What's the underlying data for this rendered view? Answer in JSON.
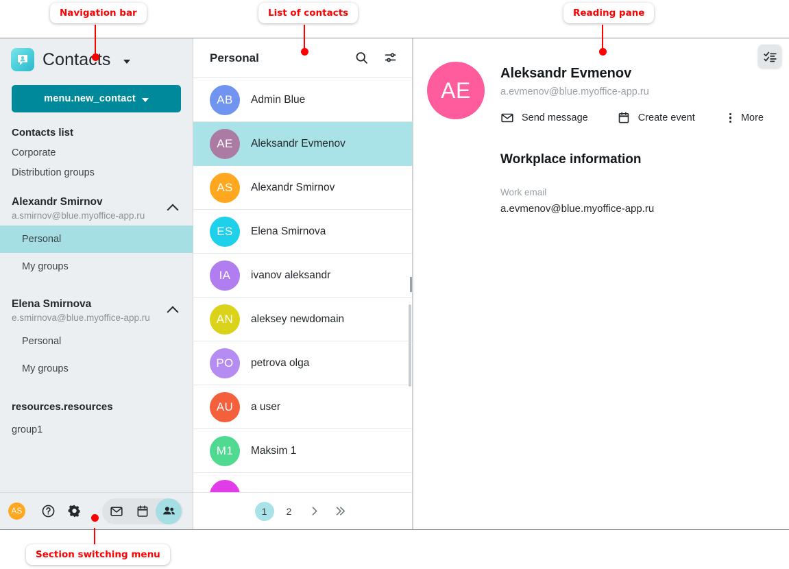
{
  "annotations": [
    {
      "label": "Navigation bar"
    },
    {
      "label": "List of contacts"
    },
    {
      "label": "Reading pane"
    },
    {
      "label": "Section switching menu"
    }
  ],
  "sidebar": {
    "brand": {
      "title": "Contacts",
      "logo_icon": "contacts-app-logo-icon",
      "caret_icon": "chevron-down-icon"
    },
    "new_button": {
      "label": "menu.new_contact",
      "caret_icon": "chevron-down-icon",
      "color": "#00889b"
    },
    "contacts_list_title": "Contacts list",
    "links": [
      {
        "label": "Corporate"
      },
      {
        "label": "Distribution groups"
      }
    ],
    "accounts": [
      {
        "name": "Alexandr Smirnov",
        "email": "a.smirnov@blue.myoffice-app.ru",
        "chevron_icon": "chevron-up-icon",
        "items": [
          {
            "label": "Personal",
            "active": true
          },
          {
            "label": "My groups",
            "active": false
          }
        ]
      },
      {
        "name": "Elena Smirnova",
        "email": "e.smirnova@blue.myoffice-app.ru",
        "chevron_icon": "chevron-up-icon",
        "items": [
          {
            "label": "Personal",
            "active": false
          },
          {
            "label": "My groups",
            "active": false
          }
        ]
      }
    ],
    "resources_title": "resources.resources",
    "resources_items": [
      {
        "label": "group1"
      }
    ],
    "bottom": {
      "avatar_initials": "AS",
      "avatar_color": "#ffa81f",
      "help_icon": "help-circle-icon",
      "settings_icon": "gear-icon",
      "sections": [
        {
          "icon": "mail-icon",
          "active": false
        },
        {
          "icon": "calendar-icon",
          "active": false
        },
        {
          "icon": "contacts-icon",
          "active": true
        }
      ]
    }
  },
  "list": {
    "title": "Personal",
    "search_icon": "search-icon",
    "filter_icon": "filter-sliders-icon",
    "contacts": [
      {
        "initials": "AB",
        "name": "Admin Blue",
        "color": "#7094f0",
        "selected": false
      },
      {
        "initials": "AE",
        "name": "Aleksandr Evmenov",
        "color": "#ab7ba3",
        "selected": true
      },
      {
        "initials": "AS",
        "name": "Alexandr Smirnov",
        "color": "#ffa81f",
        "selected": false
      },
      {
        "initials": "ES",
        "name": "Elena Smirnova",
        "color": "#1fd0ea",
        "selected": false
      },
      {
        "initials": "IA",
        "name": "ivanov aleksandr",
        "color": "#b07ef0",
        "selected": false
      },
      {
        "initials": "AN",
        "name": "aleksey newdomain",
        "color": "#dbd31a",
        "selected": false
      },
      {
        "initials": "PO",
        "name": "petrova olga",
        "color": "#b48cf2",
        "selected": false
      },
      {
        "initials": "AU",
        "name": "a user",
        "color": "#f5603c",
        "selected": false
      },
      {
        "initials": "M1",
        "name": "Maksim 1",
        "color": "#4fd991",
        "selected": false
      }
    ],
    "partial_contact_color": "#e03ce8",
    "pagination": {
      "pages": [
        {
          "label": "1",
          "active": true
        },
        {
          "label": "2",
          "active": false
        }
      ],
      "next_icon": "chevron-right-icon",
      "last_icon": "chevron-double-right-icon"
    }
  },
  "reading": {
    "avatar_initials": "AE",
    "avatar_color": "#ff5c9d",
    "name": "Aleksandr Evmenov",
    "email": "a.evmenov@blue.myoffice-app.ru",
    "actions": [
      {
        "label": "Send message",
        "icon": "envelope-icon"
      },
      {
        "label": "Create event",
        "icon": "calendar-icon"
      },
      {
        "label": "More",
        "icon": "more-vertical-icon"
      }
    ],
    "workplace": {
      "title": "Workplace information",
      "email_label": "Work email",
      "email_value": "a.evmenov@blue.myoffice-app.ru"
    },
    "task_button_icon": "checklist-icon"
  }
}
